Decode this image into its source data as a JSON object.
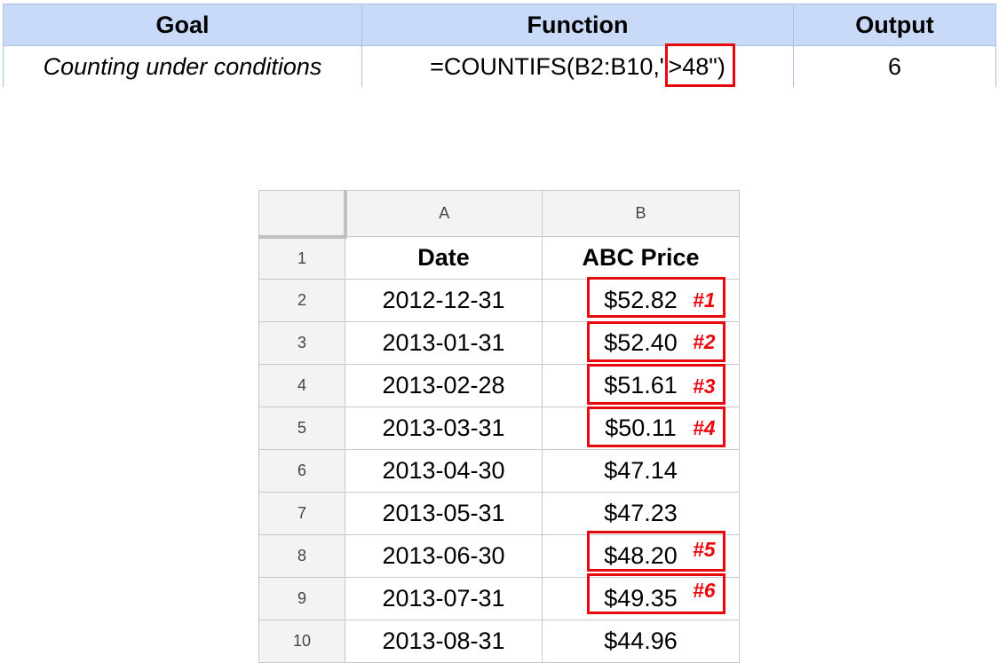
{
  "summary": {
    "headers": {
      "goal": "Goal",
      "function": "Function",
      "output": "Output"
    },
    "row": {
      "goal": "Counting under conditions",
      "formula_prefix": "=COUNTIFS(B2:B10,",
      "formula_criterion": "\">48\"",
      "formula_suffix": ")",
      "output": "6"
    }
  },
  "sheet": {
    "columns": [
      "A",
      "B"
    ],
    "header_row": {
      "num": "1",
      "date": "Date",
      "price": "ABC Price"
    },
    "rows": [
      {
        "num": "2",
        "date": "2012-12-31",
        "price": "$52.82",
        "tag": "#1"
      },
      {
        "num": "3",
        "date": "2013-01-31",
        "price": "$52.40",
        "tag": "#2"
      },
      {
        "num": "4",
        "date": "2013-02-28",
        "price": "$51.61",
        "tag": "#3"
      },
      {
        "num": "5",
        "date": "2013-03-31",
        "price": "$50.11",
        "tag": "#4"
      },
      {
        "num": "6",
        "date": "2013-04-30",
        "price": "$47.14",
        "tag": ""
      },
      {
        "num": "7",
        "date": "2013-05-31",
        "price": "$47.23",
        "tag": ""
      },
      {
        "num": "8",
        "date": "2013-06-30",
        "price": "$48.20",
        "tag": "#5"
      },
      {
        "num": "9",
        "date": "2013-07-31",
        "price": "$49.35",
        "tag": "#6"
      },
      {
        "num": "10",
        "date": "2013-08-31",
        "price": "$44.96",
        "tag": ""
      }
    ]
  },
  "colors": {
    "highlight": "#e8090f",
    "header_fill": "#c9daf8",
    "border": "#a9c1e3"
  }
}
